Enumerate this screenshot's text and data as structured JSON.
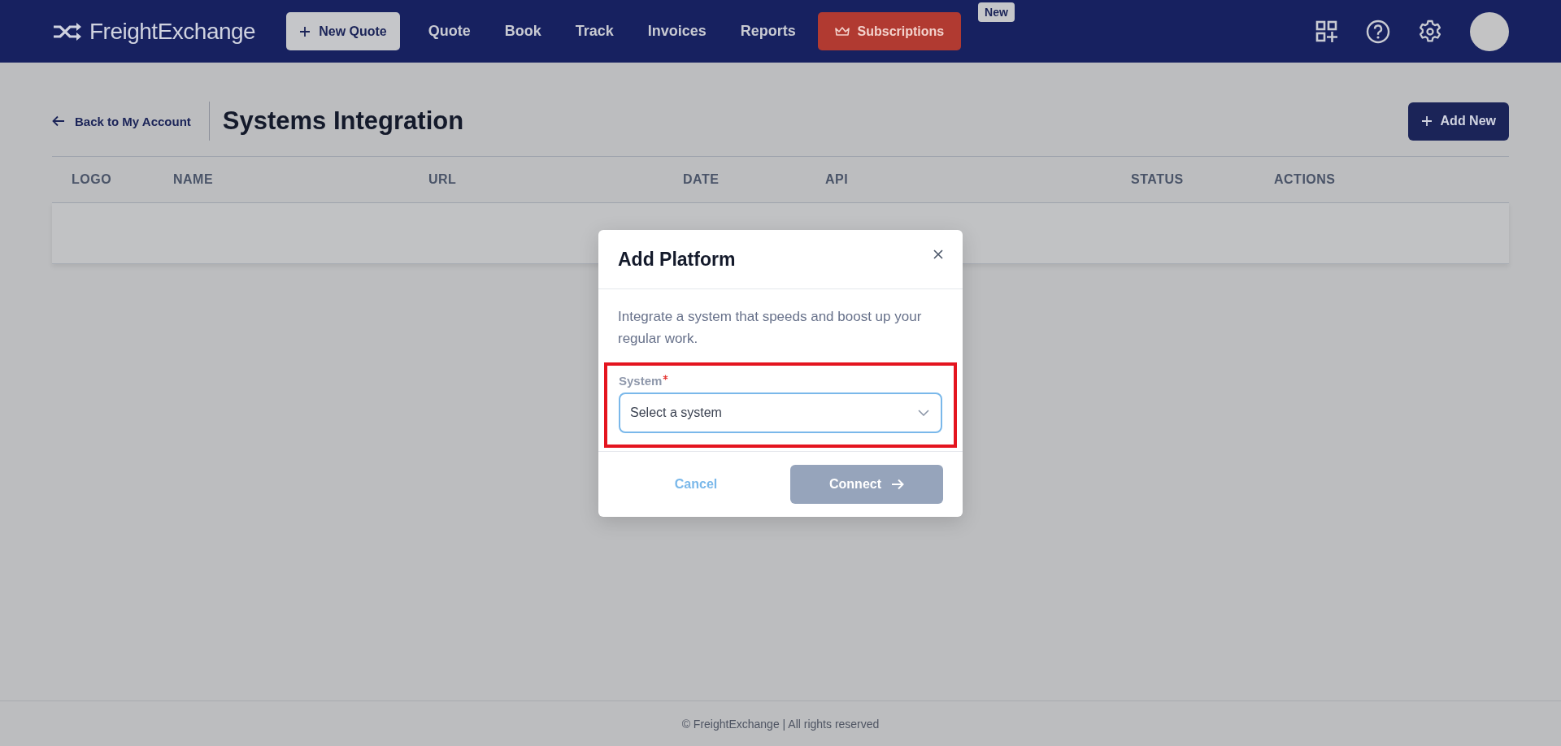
{
  "header": {
    "logo": "FreightExchange",
    "new_quote": "New Quote",
    "nav": [
      {
        "label": "Quote",
        "selected": false
      },
      {
        "label": "Book",
        "selected": false
      },
      {
        "label": "Track",
        "selected": false
      },
      {
        "label": "Invoices",
        "selected": false
      },
      {
        "label": "Reports",
        "selected": false
      }
    ],
    "subscriptions": {
      "label": "Subscriptions",
      "badge": "New"
    }
  },
  "page": {
    "back": "Back to My Account",
    "title": "Systems Integration",
    "add_new": "Add New"
  },
  "table": {
    "columns": [
      "LOGO",
      "NAME",
      "URL",
      "DATE",
      "API",
      "STATUS",
      "ACTIONS"
    ]
  },
  "dialog": {
    "title": "Add Platform",
    "description": "Integrate a system that speeds and boost up your regular work.",
    "field": {
      "label": "System",
      "required": true,
      "placeholder": "Select a system",
      "highlighted": true
    },
    "cancel": "Cancel",
    "connect": {
      "label": "Connect",
      "disabled": true
    }
  },
  "footer": "© FreightExchange | All rights reserved"
}
